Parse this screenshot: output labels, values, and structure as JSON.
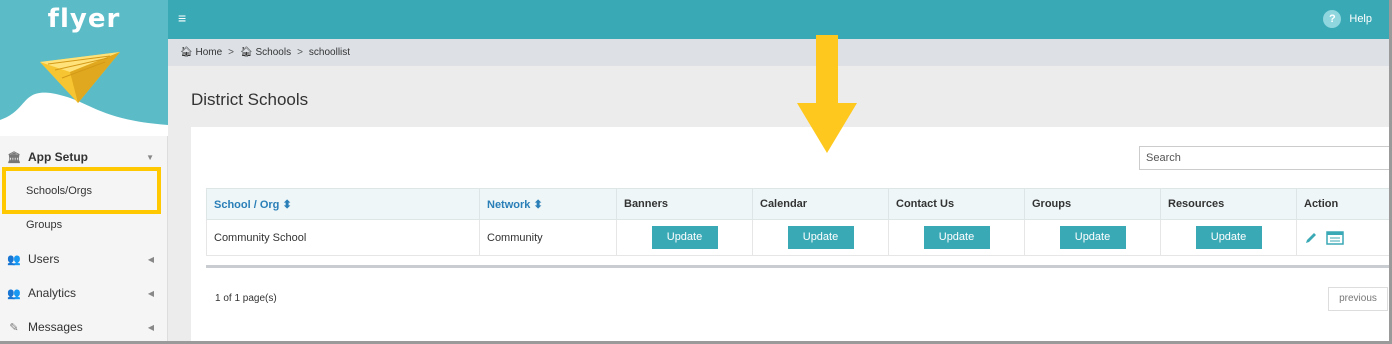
{
  "brand": {
    "logo_text": "flyer"
  },
  "topbar": {
    "help_label": "Help",
    "help_icon": "question-circle-icon",
    "menu_icon": "hamburger-icon"
  },
  "breadcrumb": {
    "items": [
      "Home",
      "Schools",
      "schoollist"
    ],
    "separator": ">"
  },
  "sidebar": {
    "section_label": "App Setup",
    "sub_items": [
      "Schools/Orgs",
      "Groups"
    ],
    "items": [
      {
        "label": "Users",
        "icon": "users-icon"
      },
      {
        "label": "Analytics",
        "icon": "users-icon"
      },
      {
        "label": "Messages",
        "icon": "pencil-icon"
      }
    ]
  },
  "main": {
    "title": "District Schools",
    "search_placeholder": "Search",
    "columns": [
      "School / Org",
      "Network",
      "Banners",
      "Calendar",
      "Contact Us",
      "Groups",
      "Resources",
      "Action"
    ],
    "sort_icon": "⬍",
    "rows": [
      {
        "school": "Community School",
        "network": "Community",
        "button_label": "Update"
      }
    ],
    "pager_text": "1 of 1 page(s)",
    "previous_label": "previous"
  },
  "colors": {
    "accent": "#3aa9b6",
    "brand": "#5bbcc7",
    "highlight": "#ffc800",
    "link": "#2a7fb8"
  }
}
